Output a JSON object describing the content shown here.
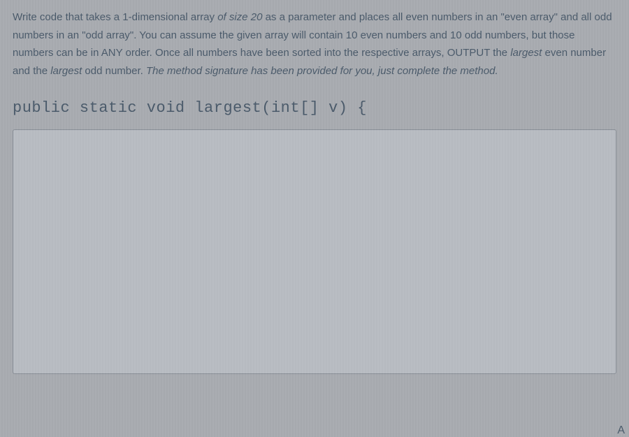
{
  "question": {
    "part1": "Write code that takes a 1-dimensional array ",
    "italic1": "of size 20",
    "part2": " as a parameter and places all even numbers in an \"even array\" and all odd numbers in an \"odd array\". You can assume the given array will contain 10 even numbers and 10 odd numbers, but those numbers can be in ANY order. Once all numbers have been sorted into the respective arrays, OUTPUT the ",
    "italic2": "largest",
    "part3": " even number and the ",
    "italic3": "largest",
    "part4": " odd number. ",
    "italic4": "The method signature has been provided for you, just complete the method."
  },
  "signature": "public static void largest(int[] v) {",
  "code_value": "",
  "corner_label": "A"
}
